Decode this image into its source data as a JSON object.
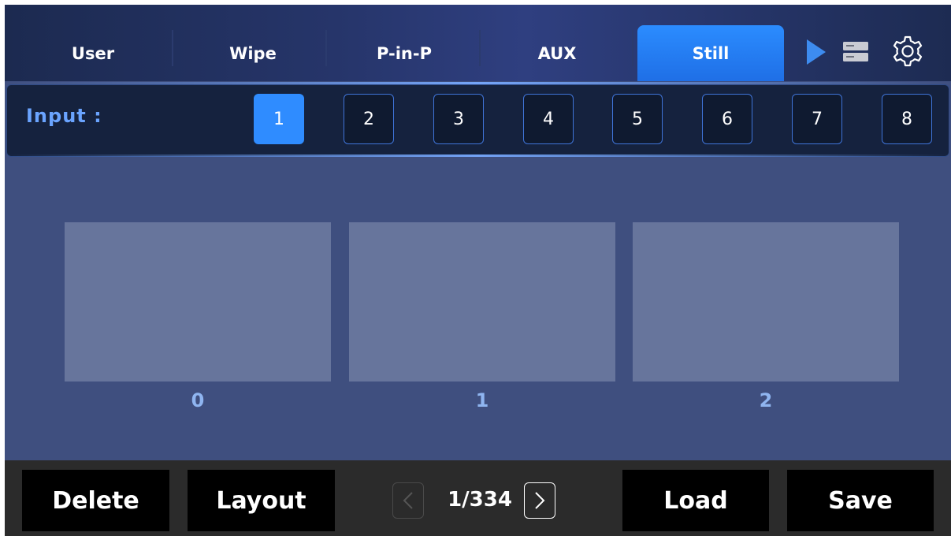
{
  "tabs": [
    {
      "label": "User",
      "active": false
    },
    {
      "label": "Wipe",
      "active": false
    },
    {
      "label": "P-in-P",
      "active": false
    },
    {
      "label": "AUX",
      "active": false
    },
    {
      "label": "Still",
      "active": true
    }
  ],
  "toolbar_icons": {
    "play": "play-icon",
    "device": "device-icon",
    "settings": "gear-icon"
  },
  "input": {
    "label": "Input :",
    "buttons": [
      "1",
      "2",
      "3",
      "4",
      "5",
      "6",
      "7",
      "8"
    ],
    "selected": "1"
  },
  "stills": [
    {
      "label": "0"
    },
    {
      "label": "1"
    },
    {
      "label": "2"
    }
  ],
  "actions": {
    "delete": "Delete",
    "layout": "Layout",
    "load": "Load",
    "save": "Save"
  },
  "pager": {
    "text": "1/334",
    "prev_enabled": false,
    "next_enabled": true
  },
  "colors": {
    "accent": "#2f8cff",
    "background": "#3f4f7f",
    "thumbnail": "#67759c",
    "label_blue": "#8fb5f0"
  }
}
